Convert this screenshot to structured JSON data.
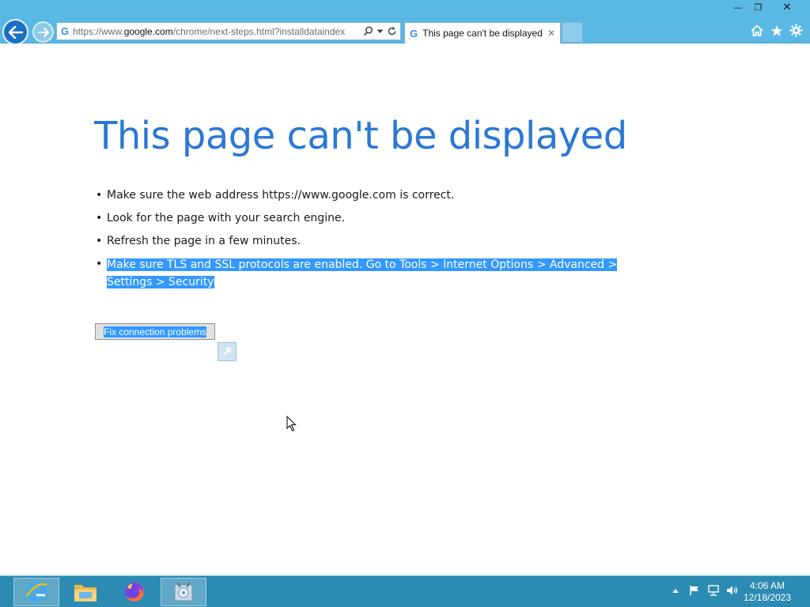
{
  "browser": {
    "url_prefix": "https://www.",
    "url_domain": "google.com",
    "url_rest": "/chrome/next-steps.html?installdataindex",
    "favicon": "G",
    "tab_title": "This page can't be displayed",
    "tab_close": "✕",
    "window_controls": {
      "minimize": "—",
      "restore": "❐",
      "close": "✕"
    }
  },
  "page": {
    "heading": "This page can't be displayed",
    "tips": [
      "Make sure the web address https://www.google.com is correct.",
      "Look for the page with your search engine.",
      "Refresh the page in a few minutes.",
      "Make sure TLS and SSL protocols are enabled. Go to Tools > Internet Options > Advanced > Settings > Security"
    ],
    "fix_button": "Fix connection problems",
    "selected_color": "#3399ff",
    "heading_color": "#2a78d4"
  },
  "taskbar": {
    "apps": [
      "internet-explorer-icon",
      "file-explorer-icon",
      "firefox-icon",
      "setup-icon"
    ],
    "clock_time": "4:06 AM",
    "clock_date": "12/18/2023"
  }
}
